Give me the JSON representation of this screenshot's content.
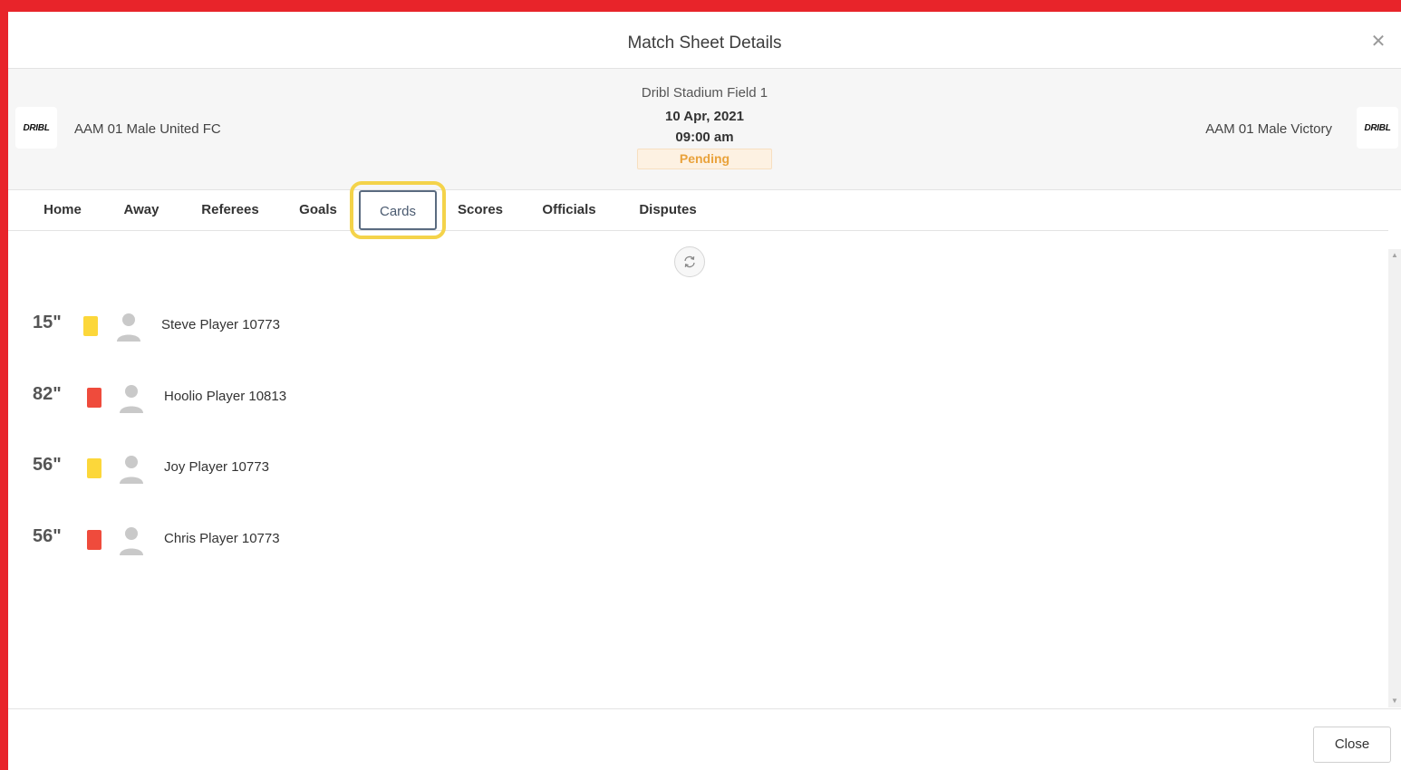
{
  "modal": {
    "title": "Match Sheet Details",
    "close_icon": "close-icon"
  },
  "match": {
    "venue": "Dribl Stadium Field 1",
    "date": "10 Apr, 2021",
    "time": "09:00 am",
    "status": "Pending",
    "home_team": {
      "name": "AAM 01 Male United FC",
      "logo_text": "DRIBL"
    },
    "away_team": {
      "name": "AAM 01 Male Victory",
      "logo_text": "DRIBL"
    }
  },
  "tabs": [
    {
      "label": "Home"
    },
    {
      "label": "Away"
    },
    {
      "label": "Referees"
    },
    {
      "label": "Goals"
    },
    {
      "label": "Cards",
      "active": true
    },
    {
      "label": "Scores"
    },
    {
      "label": "Officials"
    },
    {
      "label": "Disputes"
    }
  ],
  "cards": [
    {
      "minute": "15\"",
      "card": "yellow",
      "player": "Steve Player 10773"
    },
    {
      "minute": "82\"",
      "card": "red",
      "player": "Hoolio Player 10813"
    },
    {
      "minute": "56\"",
      "card": "yellow",
      "player": "Joy Player 10773"
    },
    {
      "minute": "56\"",
      "card": "red",
      "player": "Chris Player 10773"
    }
  ],
  "footer": {
    "close_label": "Close"
  },
  "colors": {
    "frame": "#e8242a",
    "yellow_card": "#fcd73a",
    "red_card": "#ef4b3c",
    "pending": "#e9a23b",
    "highlight": "#f4d34a"
  }
}
